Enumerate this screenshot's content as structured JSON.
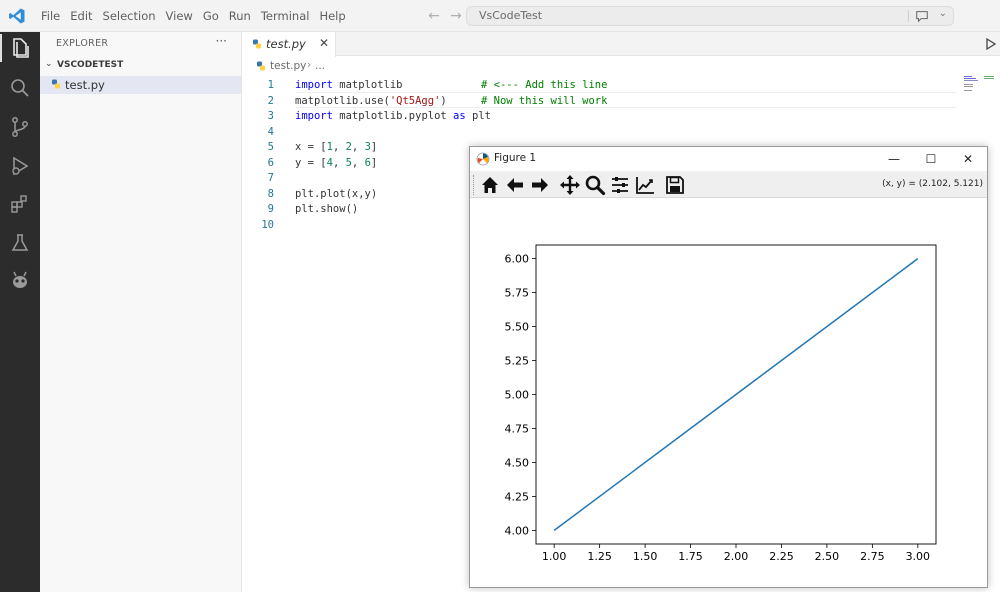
{
  "titlebar": {
    "menu": [
      "File",
      "Edit",
      "Selection",
      "View",
      "Go",
      "Run",
      "Terminal",
      "Help"
    ],
    "search_text": "VsCodeTest"
  },
  "sidebar": {
    "title": "EXPLORER",
    "more": "···",
    "folder": "VSCODETEST",
    "file": "test.py"
  },
  "editor": {
    "tab_label": "test.py",
    "tab_close": "✕",
    "breadcrumb_file": "test.py",
    "breadcrumb_sep": "›",
    "breadcrumb_more": "...",
    "lines": [
      {
        "n": "1",
        "html_key": "l1",
        "comment": "# <--- Add this line"
      },
      {
        "n": "2",
        "html_key": "l2",
        "comment": "# Now this will work"
      },
      {
        "n": "3",
        "html_key": "l3",
        "comment": ""
      },
      {
        "n": "4",
        "html_key": "l4",
        "comment": ""
      },
      {
        "n": "5",
        "html_key": "l5",
        "comment": ""
      },
      {
        "n": "6",
        "html_key": "l6",
        "comment": ""
      },
      {
        "n": "7",
        "html_key": "l7",
        "comment": ""
      },
      {
        "n": "8",
        "html_key": "l8",
        "comment": ""
      },
      {
        "n": "9",
        "html_key": "l9",
        "comment": ""
      },
      {
        "n": "10",
        "html_key": "l10",
        "comment": ""
      }
    ],
    "code": {
      "l1": [
        {
          "t": "import",
          "c": "kw"
        },
        {
          "t": " matplotlib",
          "c": ""
        }
      ],
      "l2": [
        {
          "t": "matplotlib.use(",
          "c": ""
        },
        {
          "t": "'Qt5Agg'",
          "c": "str"
        },
        {
          "t": ")",
          "c": ""
        }
      ],
      "l3": [
        {
          "t": "import",
          "c": "kw"
        },
        {
          "t": " matplotlib.pyplot ",
          "c": ""
        },
        {
          "t": "as",
          "c": "kw"
        },
        {
          "t": " plt",
          "c": ""
        }
      ],
      "l4": [],
      "l5": [
        {
          "t": "x = [",
          "c": ""
        },
        {
          "t": "1",
          "c": "num"
        },
        {
          "t": ", ",
          "c": ""
        },
        {
          "t": "2",
          "c": "num"
        },
        {
          "t": ", ",
          "c": ""
        },
        {
          "t": "3",
          "c": "num"
        },
        {
          "t": "]",
          "c": ""
        }
      ],
      "l6": [
        {
          "t": "y = [",
          "c": ""
        },
        {
          "t": "4",
          "c": "num"
        },
        {
          "t": ", ",
          "c": ""
        },
        {
          "t": "5",
          "c": "num"
        },
        {
          "t": ", ",
          "c": ""
        },
        {
          "t": "6",
          "c": "num"
        },
        {
          "t": "]",
          "c": ""
        }
      ],
      "l7": [],
      "l8": [
        {
          "t": "plt.plot(x,y)",
          "c": ""
        }
      ],
      "l9": [
        {
          "t": "plt.show()",
          "c": ""
        }
      ],
      "l10": []
    }
  },
  "figure": {
    "title": "Figure 1",
    "minimize": "—",
    "maximize": "☐",
    "close": "✕",
    "coord_readout": "(x, y) = (2.102, 5.121)",
    "toolbar_icons": [
      "home-icon",
      "back-arrow-icon",
      "forward-arrow-icon",
      "pan-icon",
      "zoom-icon",
      "subplots-config-icon",
      "edit-axis-icon",
      "save-icon"
    ]
  },
  "chart_data": {
    "type": "line",
    "series": [
      {
        "x": [
          1,
          2,
          3
        ],
        "y": [
          4,
          5,
          6
        ],
        "color": "#1f77b4"
      }
    ],
    "xlim": [
      0.9,
      3.1
    ],
    "ylim": [
      3.9,
      6.1
    ],
    "xticks": [
      1.0,
      1.25,
      1.5,
      1.75,
      2.0,
      2.25,
      2.5,
      2.75,
      3.0
    ],
    "xtick_labels": [
      "1.00",
      "1.25",
      "1.50",
      "1.75",
      "2.00",
      "2.25",
      "2.50",
      "2.75",
      "3.00"
    ],
    "yticks": [
      4.0,
      4.25,
      4.5,
      4.75,
      5.0,
      5.25,
      5.5,
      5.75,
      6.0
    ],
    "ytick_labels": [
      "4.00",
      "4.25",
      "4.50",
      "4.75",
      "5.00",
      "5.25",
      "5.50",
      "5.75",
      "6.00"
    ],
    "grid": false
  }
}
